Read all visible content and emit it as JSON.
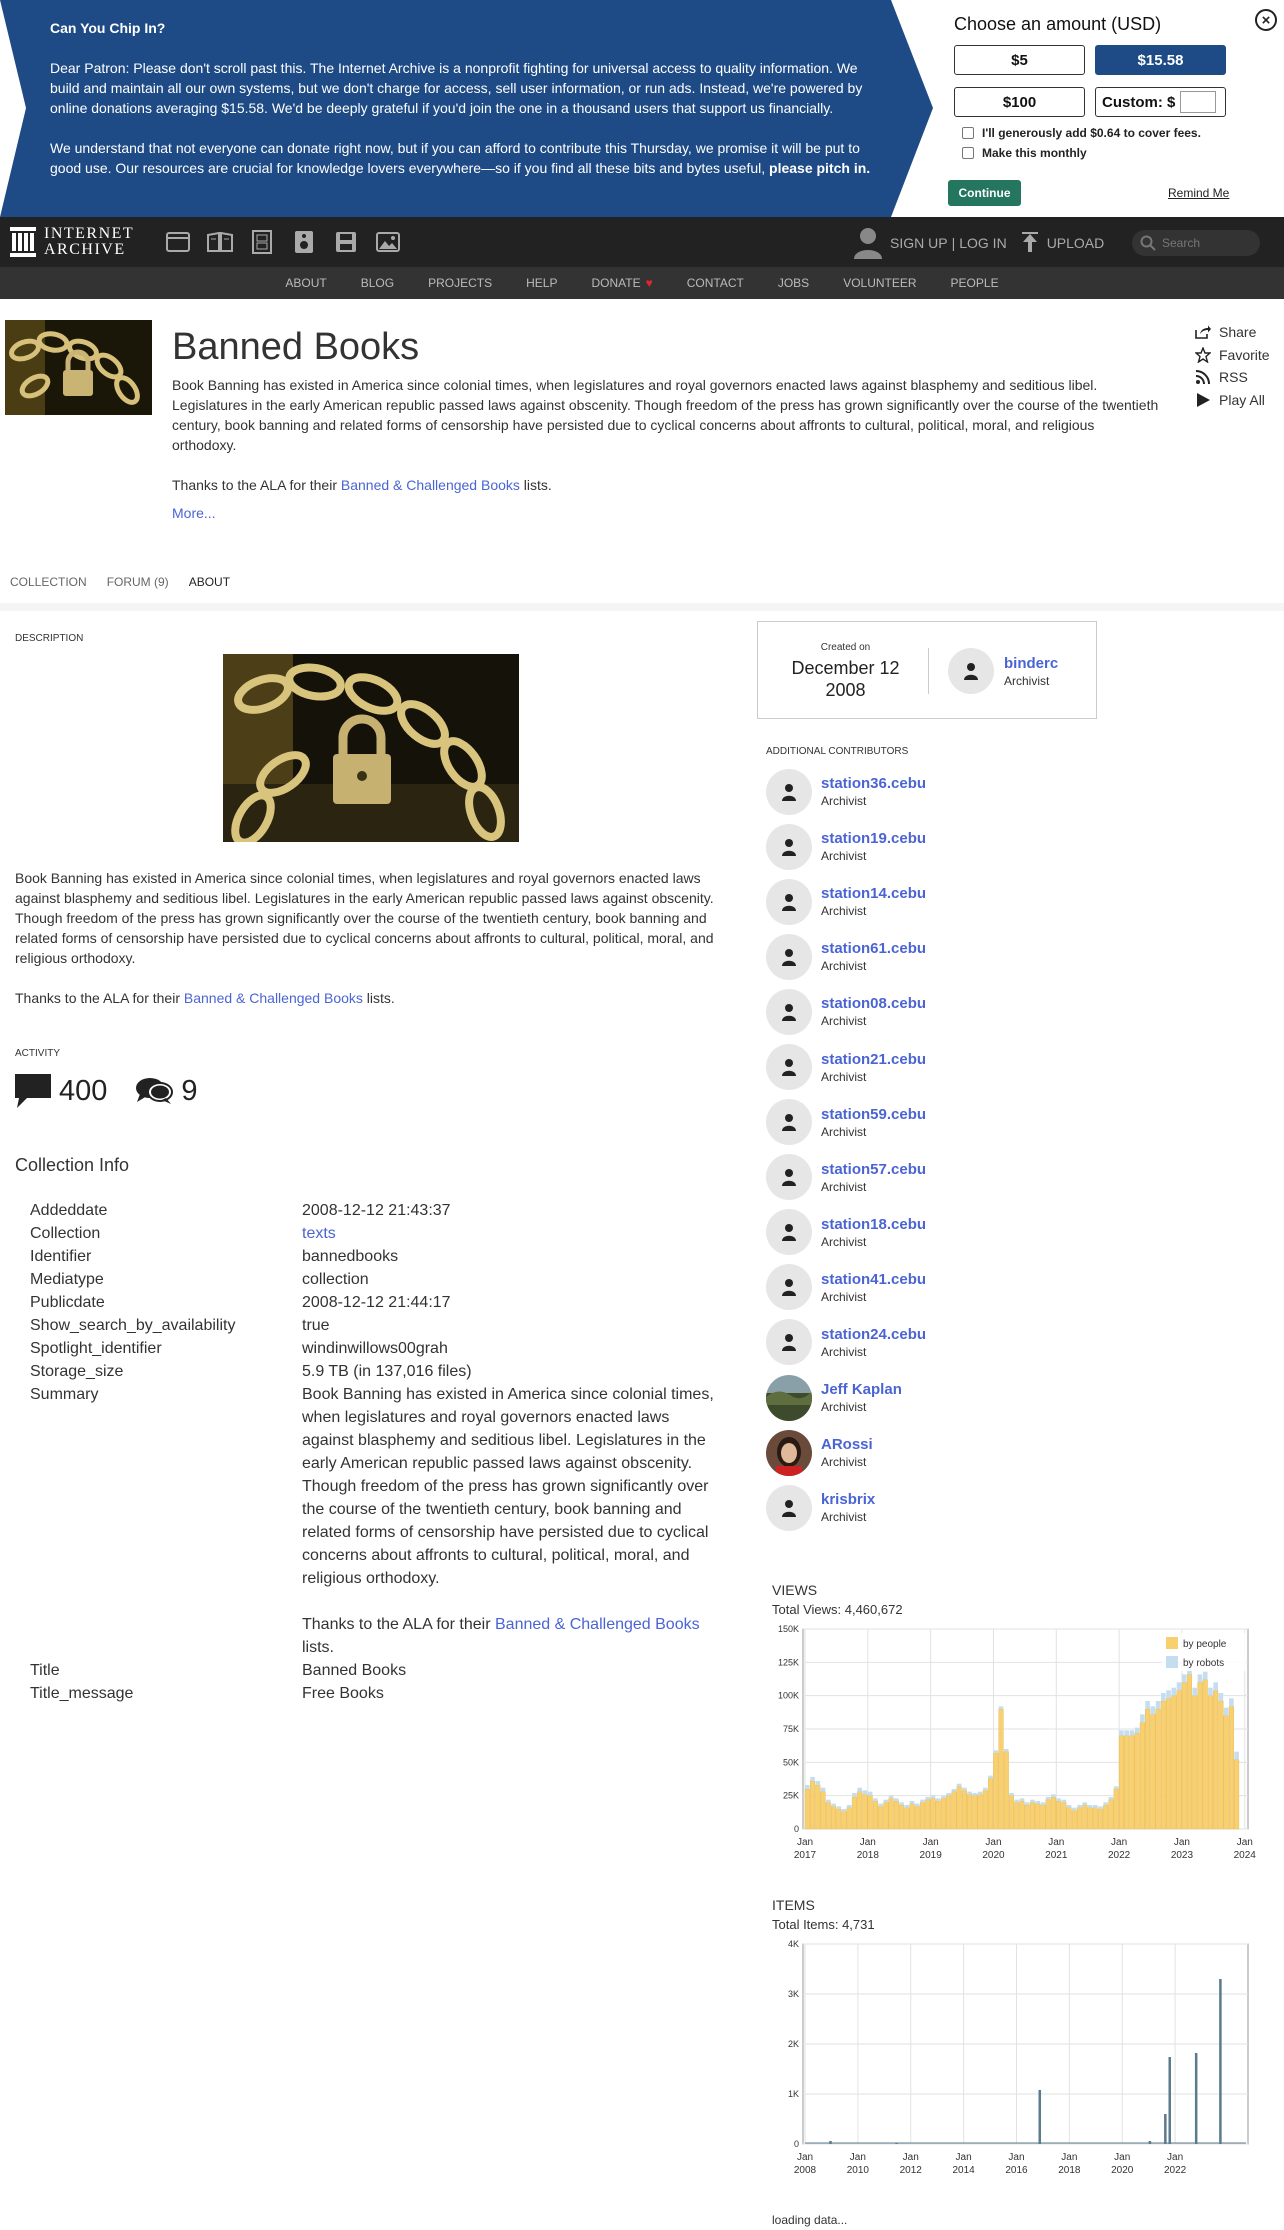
{
  "banner": {
    "heading": "Can You Chip In?",
    "para1": "Dear Patron: Please don't scroll past this. The Internet Archive is a nonprofit fighting for universal access to quality information. We build and maintain all our own systems, but we don't charge for access, sell user information, or run ads. Instead, we're powered by online donations averaging $15.58. We'd be deeply grateful if you'd join the one in a thousand users that support us financially.",
    "para2": "We understand that not everyone can donate right now, but if you can afford to contribute this Thursday, we promise it will be put to good use. Our resources are crucial for knowledge lovers everywhere—so if you find all these bits and bytes useful, ",
    "para2_bold": "please pitch in.",
    "choose": "Choose an amount (USD)",
    "amounts": [
      "$5",
      "$15.58",
      "$100"
    ],
    "custom_label": "Custom: $",
    "fee_label": "I'll generously add $0.64 to cover fees.",
    "monthly_label": "Make this monthly",
    "continue": "Continue",
    "remind": "Remind Me",
    "close": "×",
    "accent": "#1e4b86"
  },
  "topnav": {
    "logo_line1": "INTERNET",
    "logo_line2": "ARCHIVE",
    "media_icons": [
      "web-icon",
      "texts-icon",
      "video-icon",
      "audio-icon",
      "software-icon",
      "images-icon"
    ],
    "signup": "SIGN UP",
    "sep": "|",
    "login": "LOG IN",
    "upload": "UPLOAD",
    "search_placeholder": "Search"
  },
  "subnav": [
    "ABOUT",
    "BLOG",
    "PROJECTS",
    "HELP",
    "DONATE",
    "CONTACT",
    "JOBS",
    "VOLUNTEER",
    "PEOPLE"
  ],
  "header": {
    "title": "Banned Books",
    "description": "Book Banning has existed in America since colonial times, when legislatures and royal governors enacted laws against blasphemy and seditious libel. Legislatures in the early American republic passed laws against obscenity. Though freedom of the press has grown significantly over the course of the twentieth century, book banning and related forms of censorship have persisted due to cyclical concerns about affronts to cultural, political, moral, and religious orthodoxy.",
    "thanks_pre": "Thanks to the ALA for their ",
    "thanks_link": "Banned & Challenged Books",
    "thanks_post": " lists.",
    "more": "More..."
  },
  "actions": [
    "Share",
    "Favorite",
    "RSS",
    "Play All"
  ],
  "tabs": [
    "COLLECTION",
    "FORUM (9)",
    "ABOUT"
  ],
  "about": {
    "description_label": "DESCRIPTION",
    "activity_label": "ACTIVITY",
    "reviews_count": "400",
    "forum_count": "9",
    "collection_info_title": "Collection Info",
    "info": [
      {
        "k": "Addeddate",
        "v": "2008-12-12 21:43:37"
      },
      {
        "k": "Collection",
        "v": "texts",
        "link": true
      },
      {
        "k": "Identifier",
        "v": "bannedbooks"
      },
      {
        "k": "Mediatype",
        "v": "collection"
      },
      {
        "k": "Publicdate",
        "v": "2008-12-12 21:44:17"
      },
      {
        "k": "Show_search_by_availability",
        "v": "true"
      },
      {
        "k": "Spotlight_identifier",
        "v": "windinwillows00grah"
      },
      {
        "k": "Storage_size",
        "v": "5.9 TB (in 137,016 files)"
      },
      {
        "k": "Summary",
        "v": "summary"
      },
      {
        "k": "Title",
        "v": "Banned Books"
      },
      {
        "k": "Title_message",
        "v": "Free Books"
      }
    ]
  },
  "sidebar": {
    "created_label": "Created on",
    "created_date_line1": "December 12",
    "created_date_line2": "2008",
    "owner_name": "binderc",
    "owner_role": "Archivist",
    "contrib_label": "ADDITIONAL CONTRIBUTORS",
    "contributors": [
      {
        "name": "station36.cebu",
        "role": "Archivist",
        "avatar": "person-icon"
      },
      {
        "name": "station19.cebu",
        "role": "Archivist",
        "avatar": "person-icon"
      },
      {
        "name": "station14.cebu",
        "role": "Archivist",
        "avatar": "person-icon"
      },
      {
        "name": "station61.cebu",
        "role": "Archivist",
        "avatar": "person-icon"
      },
      {
        "name": "station08.cebu",
        "role": "Archivist",
        "avatar": "person-icon"
      },
      {
        "name": "station21.cebu",
        "role": "Archivist",
        "avatar": "person-icon"
      },
      {
        "name": "station59.cebu",
        "role": "Archivist",
        "avatar": "person-icon"
      },
      {
        "name": "station57.cebu",
        "role": "Archivist",
        "avatar": "person-icon"
      },
      {
        "name": "station18.cebu",
        "role": "Archivist",
        "avatar": "person-icon"
      },
      {
        "name": "station41.cebu",
        "role": "Archivist",
        "avatar": "person-icon"
      },
      {
        "name": "station24.cebu",
        "role": "Archivist",
        "avatar": "person-icon"
      },
      {
        "name": "Jeff Kaplan",
        "role": "Archivist",
        "avatar": "photo-landscape"
      },
      {
        "name": "ARossi",
        "role": "Archivist",
        "avatar": "photo-portrait"
      },
      {
        "name": "krisbrix",
        "role": "Archivist",
        "avatar": "person-icon"
      }
    ],
    "views_label": "VIEWS",
    "views_total": "Total Views: 4,460,672",
    "items_label": "ITEMS",
    "items_total": "Total Items: 4,731",
    "loading": "loading data..."
  },
  "chart_data": [
    {
      "type": "bar",
      "title": "VIEWS",
      "stacked": true,
      "x_axis": "months",
      "x_start": "2017-01",
      "ylim": [
        0,
        150000
      ],
      "yticks": [
        "0",
        "25K",
        "50K",
        "75K",
        "100K",
        "125K",
        "150K"
      ],
      "xticks": [
        [
          "Jan",
          "2017"
        ],
        [
          "Jan",
          "2018"
        ],
        [
          "Jan",
          "2019"
        ],
        [
          "Jan",
          "2020"
        ],
        [
          "Jan",
          "2021"
        ],
        [
          "Jan",
          "2022"
        ],
        [
          "Jan",
          "2023"
        ],
        [
          "Jan",
          "2024"
        ]
      ],
      "legend": "top-right",
      "series": [
        {
          "name": "by people",
          "color": "#f8d070",
          "values": [
            30000,
            36000,
            33000,
            28000,
            20000,
            17000,
            15000,
            13000,
            16000,
            24000,
            28000,
            26000,
            25000,
            21000,
            17000,
            20000,
            23000,
            21000,
            18000,
            16000,
            19000,
            17000,
            20000,
            22000,
            23000,
            21000,
            23000,
            25000,
            28000,
            32000,
            29000,
            26000,
            25000,
            26000,
            29000,
            38000,
            57000,
            90000,
            58000,
            25000,
            20000,
            21000,
            18000,
            20000,
            19000,
            18000,
            22000,
            24000,
            21000,
            20000,
            16000,
            14000,
            16000,
            18000,
            16000,
            16000,
            15000,
            18000,
            22000,
            30000,
            70000,
            70000,
            70000,
            72000,
            80000,
            90000,
            86000,
            90000,
            96000,
            98000,
            100000,
            104000,
            110000,
            116000,
            100000,
            110000,
            112000,
            100000,
            104000,
            96000,
            85000,
            92000,
            52000
          ]
        },
        {
          "name": "by robots",
          "color": "#c4def0",
          "values": [
            3000,
            3000,
            3000,
            3000,
            2000,
            2000,
            2000,
            2000,
            2000,
            3000,
            3000,
            3000,
            3000,
            2000,
            2000,
            2000,
            2000,
            2000,
            2000,
            2000,
            2000,
            2000,
            2000,
            2000,
            2000,
            2000,
            2000,
            2000,
            2000,
            2000,
            2000,
            2000,
            2000,
            2000,
            2000,
            2000,
            2000,
            2000,
            2000,
            2000,
            2000,
            2000,
            2000,
            2000,
            2000,
            2000,
            2000,
            2000,
            2000,
            2000,
            2000,
            2000,
            2000,
            2000,
            2000,
            2000,
            2000,
            2000,
            2000,
            2000,
            4000,
            4000,
            4000,
            4000,
            6000,
            6000,
            6000,
            6000,
            6000,
            6000,
            6000,
            6000,
            6000,
            6000,
            6000,
            6000,
            6000,
            6000,
            6000,
            6000,
            6000,
            6000,
            6000
          ]
        }
      ]
    },
    {
      "type": "bar",
      "title": "ITEMS",
      "x_axis": "months",
      "x_start": "2008-01",
      "ylim": [
        0,
        4000
      ],
      "yticks": [
        "0",
        "1K",
        "2K",
        "3K",
        "4K"
      ],
      "xticks": [
        [
          "Jan",
          "2008"
        ],
        [
          "Jan",
          "2010"
        ],
        [
          "Jan",
          "2012"
        ],
        [
          "Jan",
          "2014"
        ],
        [
          "Jan",
          "2016"
        ],
        [
          "Jan",
          "2018"
        ],
        [
          "Jan",
          "2020"
        ],
        [
          "Jan",
          "2022"
        ]
      ],
      "series": [
        {
          "name": "",
          "color": "#5b7a8c",
          "points": [
            [
              "2008-12",
              60
            ],
            [
              "2011-06",
              10
            ],
            [
              "2016-11",
              1080
            ],
            [
              "2021-01",
              60
            ],
            [
              "2021-08",
              600
            ],
            [
              "2021-10",
              1740
            ],
            [
              "2022-10",
              1820
            ],
            [
              "2023-09",
              3300
            ]
          ]
        }
      ]
    }
  ]
}
